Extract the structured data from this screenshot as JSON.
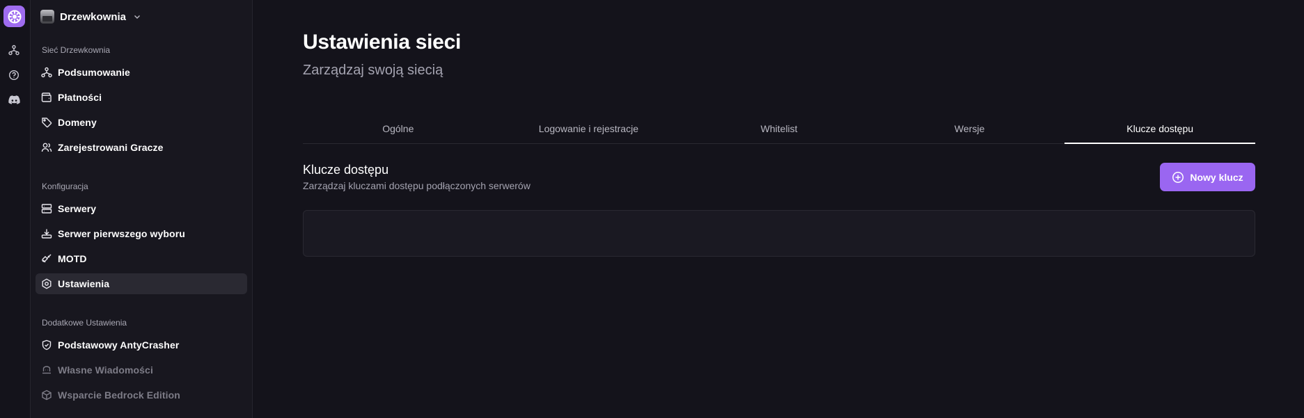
{
  "workspace": {
    "name": "Drzewkownia"
  },
  "rail": {
    "items": [
      {
        "icon": "network-icon"
      },
      {
        "icon": "help-circle-icon"
      },
      {
        "icon": "discord-icon"
      }
    ]
  },
  "sidebar": {
    "sections": [
      {
        "title": "Sieć Drzewkownia",
        "items": [
          {
            "label": "Podsumowanie",
            "icon": "network-icon"
          },
          {
            "label": "Płatności",
            "icon": "wallet-icon"
          },
          {
            "label": "Domeny",
            "icon": "tag-icon"
          },
          {
            "label": "Zarejestrowani Gracze",
            "icon": "users-icon"
          }
        ]
      },
      {
        "title": "Konfiguracja",
        "items": [
          {
            "label": "Serwery",
            "icon": "server-icon"
          },
          {
            "label": "Serwer pierwszego wyboru",
            "icon": "download-tray-icon"
          },
          {
            "label": "MOTD",
            "icon": "brush-icon"
          },
          {
            "label": "Ustawienia",
            "icon": "settings-icon",
            "active": true
          }
        ]
      },
      {
        "title": "Dodatkowe Ustawienia",
        "items": [
          {
            "label": "Podstawowy AntyCrasher",
            "icon": "shield-check-icon"
          },
          {
            "label": "Własne Wiadomości",
            "icon": "message-icon",
            "disabled": true
          },
          {
            "label": "Wsparcie Bedrock Edition",
            "icon": "cube-icon",
            "disabled": true
          }
        ]
      }
    ]
  },
  "main": {
    "title": "Ustawienia sieci",
    "subtitle": "Zarządzaj swoją siecią",
    "tabs": [
      {
        "label": "Ogólne"
      },
      {
        "label": "Logowanie i rejestracje"
      },
      {
        "label": "Whitelist"
      },
      {
        "label": "Wersje"
      },
      {
        "label": "Klucze dostępu",
        "active": true
      }
    ],
    "section": {
      "title": "Klucze dostępu",
      "description": "Zarządzaj kluczami dostępu podłączonych serwerów",
      "new_button": "Nowy klucz"
    }
  },
  "colors": {
    "accent": "#9a66f1",
    "background": "#14131b",
    "sidebar": "#18171f"
  }
}
